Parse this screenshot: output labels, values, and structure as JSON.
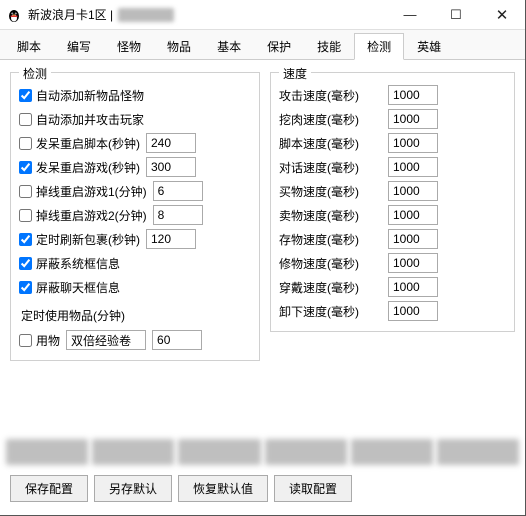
{
  "window": {
    "title": "新波浪月卡1区",
    "icon": "penguin-icon"
  },
  "tabs": [
    "脚本",
    "编写",
    "怪物",
    "物品",
    "基本",
    "保护",
    "技能",
    "检测",
    "英雄"
  ],
  "active_tab_index": 7,
  "detect_group_title": "检测",
  "detect_options": [
    {
      "label": "自动添加新物品怪物",
      "checked": true,
      "has_input": false
    },
    {
      "label": "自动添加并攻击玩家",
      "checked": false,
      "has_input": false
    },
    {
      "label": "发呆重启脚本(秒钟)",
      "checked": false,
      "has_input": true,
      "value": "240"
    },
    {
      "label": "发呆重启游戏(秒钟)",
      "checked": true,
      "has_input": true,
      "value": "300"
    },
    {
      "label": "掉线重启游戏1(分钟)",
      "checked": false,
      "has_input": true,
      "value": "6"
    },
    {
      "label": "掉线重启游戏2(分钟)",
      "checked": false,
      "has_input": true,
      "value": "8"
    },
    {
      "label": "定时刷新包裹(秒钟)",
      "checked": true,
      "has_input": true,
      "value": "120"
    },
    {
      "label": "屏蔽系统框信息",
      "checked": true,
      "has_input": false
    },
    {
      "label": "屏蔽聊天框信息",
      "checked": true,
      "has_input": false
    }
  ],
  "timed_item_label": "定时使用物品(分钟)",
  "timed_item": {
    "use_label": "用物",
    "use_checked": false,
    "item_name": "双倍经验卷",
    "minutes": "60"
  },
  "speed_group_title": "速度",
  "speeds": [
    {
      "label": "攻击速度(毫秒)",
      "value": "1000"
    },
    {
      "label": "挖肉速度(毫秒)",
      "value": "1000"
    },
    {
      "label": "脚本速度(毫秒)",
      "value": "1000"
    },
    {
      "label": "对话速度(毫秒)",
      "value": "1000"
    },
    {
      "label": "买物速度(毫秒)",
      "value": "1000"
    },
    {
      "label": "卖物速度(毫秒)",
      "value": "1000"
    },
    {
      "label": "存物速度(毫秒)",
      "value": "1000"
    },
    {
      "label": "修物速度(毫秒)",
      "value": "1000"
    },
    {
      "label": "穿戴速度(毫秒)",
      "value": "1000"
    },
    {
      "label": "卸下速度(毫秒)",
      "value": "1000"
    }
  ],
  "footer_buttons": [
    "保存配置",
    "另存默认",
    "恢复默认值",
    "读取配置"
  ]
}
